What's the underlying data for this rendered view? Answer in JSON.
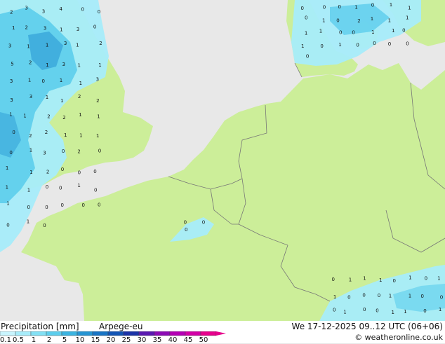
{
  "footer": {
    "title": "Precipitation [mm]",
    "model": "Arpege-eu",
    "valid_time": "We 17-12-2025 09..12 UTC (06+06)",
    "credit": "© weatheronline.co.uk"
  },
  "legend": {
    "labels": [
      "0.1",
      "0.5",
      "1",
      "2",
      "5",
      "10",
      "15",
      "20",
      "25",
      "30",
      "35",
      "40",
      "45",
      "50"
    ],
    "colors": [
      "#c8f5ff",
      "#a6ecfa",
      "#82e0f4",
      "#5ccdec",
      "#3bb3e0",
      "#2594d2",
      "#1874c4",
      "#1254b4",
      "#1a32a6",
      "#5a18b0",
      "#8c0ab4",
      "#b400b4",
      "#d200a6",
      "#e6008c"
    ]
  },
  "map": {
    "land_color": "#ccee99",
    "sea_color": "#e8e8e8",
    "precip_colors": {
      "light": "#a6ecfa",
      "medium": "#5ccdec",
      "heavy": "#2594d2"
    },
    "marker_groups": [
      {
        "region": "north-sea-west",
        "values": [
          "2",
          "3",
          "3",
          "4",
          "0",
          "0",
          "1",
          "2",
          "3",
          "1",
          "3",
          "0",
          "3",
          "1",
          "1",
          "3",
          "1",
          "2",
          "5",
          "2",
          "1",
          "3",
          "1",
          "1",
          "3",
          "1",
          "0",
          "1",
          "1",
          "3",
          "3",
          "3",
          "1",
          "1",
          "2",
          "2",
          "1",
          "1",
          "2",
          "2",
          "1",
          "1",
          "0",
          "2",
          "2",
          "1",
          "1",
          "1",
          "0",
          "1",
          "3",
          "0",
          "2",
          "0",
          "1",
          "1",
          "2",
          "0",
          "0",
          "0",
          "1",
          "1",
          "0",
          "0",
          "1",
          "0",
          "1",
          "0",
          "0",
          "0",
          "0",
          "0",
          "0",
          "1",
          "0"
        ]
      },
      {
        "region": "denmark-baltic",
        "values": [
          "0",
          "0",
          "0",
          "1",
          "0",
          "1",
          "1",
          "0",
          "1",
          "0",
          "2",
          "1",
          "1",
          "1",
          "1",
          "1",
          "0",
          "0",
          "1",
          "1",
          "0",
          "1",
          "0",
          "1",
          "0",
          "0",
          "0",
          "0",
          "0"
        ]
      },
      {
        "region": "channel-cell",
        "values": [
          "0",
          "0",
          "0"
        ]
      },
      {
        "region": "alps-south",
        "values": [
          "0",
          "1",
          "1",
          "1",
          "0",
          "1",
          "0",
          "1",
          "1",
          "0",
          "0",
          "0",
          "1",
          "1",
          "0",
          "0",
          "0",
          "1",
          "0",
          "0",
          "1",
          "1",
          "0",
          "1"
        ]
      }
    ]
  }
}
